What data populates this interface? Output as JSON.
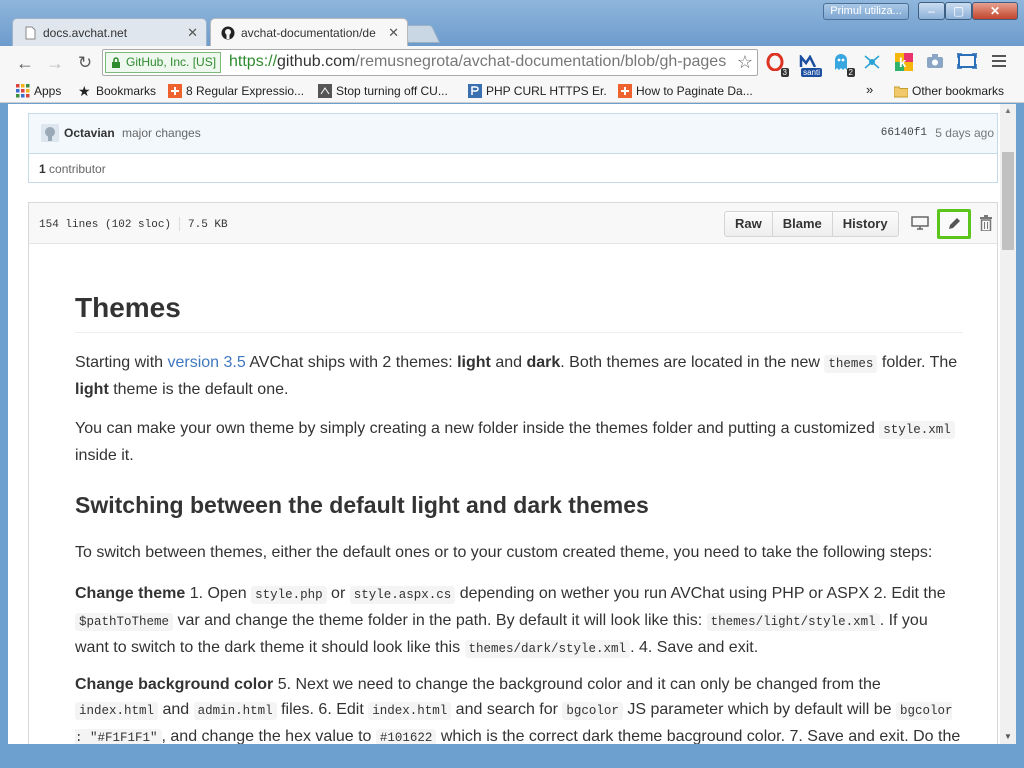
{
  "window": {
    "profile_label": "Primul utiliza...",
    "min_label": "–",
    "max_label": "▢",
    "close_label": "✕"
  },
  "tabs": [
    {
      "title": "docs.avchat.net",
      "close": "✕"
    },
    {
      "title": "avchat-documentation/de",
      "close": "✕"
    }
  ],
  "omnibox": {
    "ev_label": "GitHub, Inc. [US]",
    "scheme": "https://",
    "host": "github.com",
    "path": "/remusnegrota/avchat-documentation/blob/gh-pages"
  },
  "extensions": {
    "opera_badge": "3",
    "santi_label": "santi",
    "ghost_badge": "2",
    "k_label": "k"
  },
  "bookmarks": {
    "items": [
      {
        "label": "Apps"
      },
      {
        "label": "Bookmarks"
      },
      {
        "label": "8 Regular Expressio..."
      },
      {
        "label": "Stop turning off CU..."
      },
      {
        "label": "PHP CURL HTTPS Er..."
      },
      {
        "label": "How to Paginate Da..."
      }
    ],
    "more": "»",
    "other": "Other bookmarks"
  },
  "commit": {
    "author": "Octavian",
    "message": "major changes",
    "sha": "66140f1",
    "age": "5 days ago",
    "contributors_count": "1",
    "contributors_label": "contributor"
  },
  "file": {
    "lines": "154 lines (102 sloc)",
    "size": "7.5 KB",
    "buttons": {
      "raw": "Raw",
      "blame": "Blame",
      "history": "History"
    }
  },
  "article": {
    "h1": "Themes",
    "p1": {
      "t1": "Starting with ",
      "link": "version 3.5",
      "t2": " AVChat ships with 2 themes: ",
      "b1": "light",
      "t3": " and ",
      "b2": "dark",
      "t4": ". Both themes are located in the new ",
      "c1": "themes",
      "t5": " folder. The ",
      "b3": "light",
      "t6": " theme is the default one."
    },
    "p2": {
      "t1": "You can make your own theme by simply creating a new folder inside the themes folder and putting a customized ",
      "c1": "style.xml",
      "t2": " inside it."
    },
    "h2": "Switching between the default light and dark themes",
    "p3": "To switch between themes, either the default ones or to your custom created theme, you need to take the following steps:",
    "p4": {
      "b1": "Change theme",
      "t1": " 1. Open ",
      "c1": "style.php",
      "t2": " or ",
      "c2": "style.aspx.cs",
      "t3": " depending on wether you run AVChat using PHP or ASPX 2. Edit the ",
      "c3": "$pathToTheme",
      "t4": " var and change the theme folder in the path. By default it will look like this: ",
      "c4": "themes/light/style.xml",
      "t5": ". If you want to switch to the dark theme it should look like this ",
      "c5": "themes/dark/style.xml",
      "t6": ". 4. Save and exit."
    },
    "p5": {
      "b1": "Change background color",
      "t1": " 5. Next we need to change the background color and it can only be changed from the ",
      "c1": "index.html",
      "t2": " and ",
      "c2": "admin.html",
      "t3": " files. 6. Edit ",
      "c3": "index.html",
      "t4": " and search for ",
      "c4": "bgcolor",
      "t5": " JS parameter which by default will be ",
      "c5": "bgcolor : \"#F1F1F1\"",
      "t6": ", and change the hex value to ",
      "c6": "#101622",
      "t7": " which is the correct dark theme bacground color. 7. Save and exit. Do the"
    }
  },
  "colors": {
    "accent_link": "#4078c0",
    "edit_highlight": "#5ac41d",
    "ev_green": "#2e8b2e"
  }
}
